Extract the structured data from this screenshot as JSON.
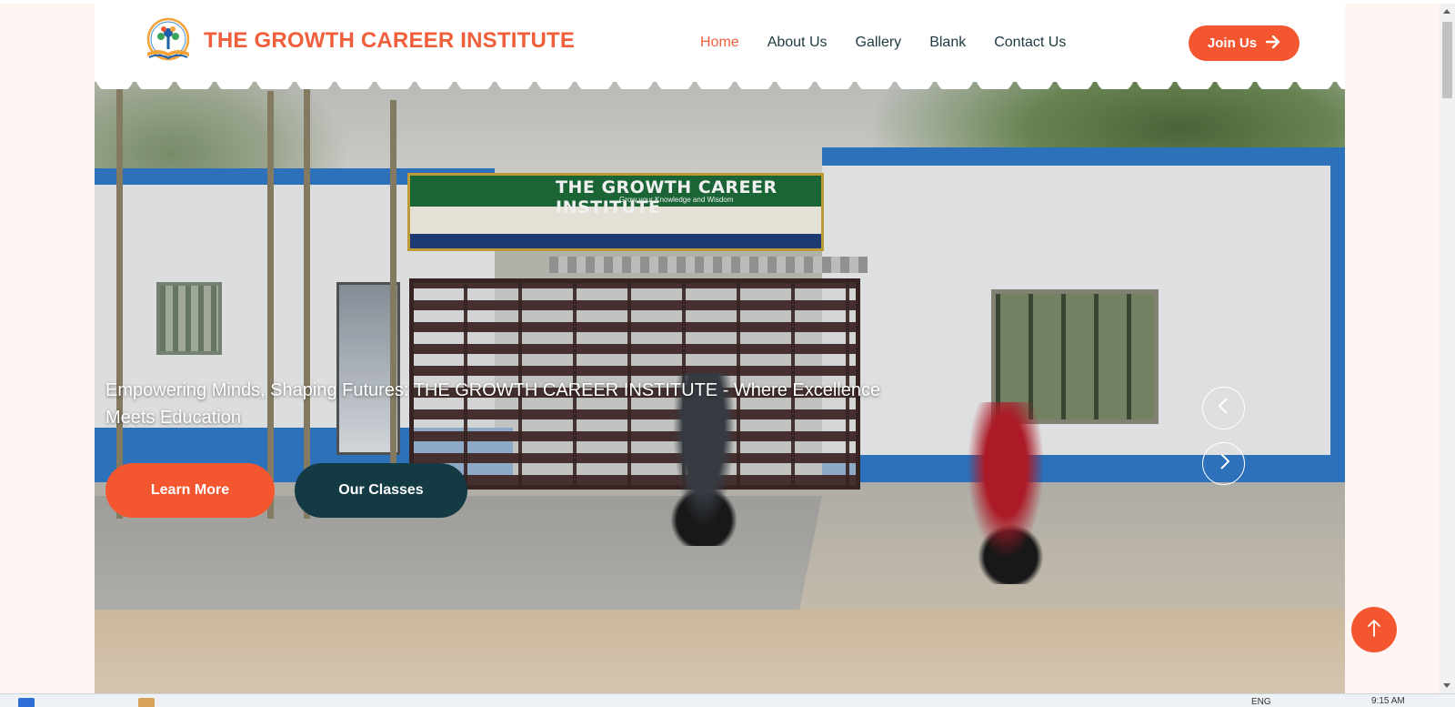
{
  "header": {
    "brand": "THE GROWTH CAREER INSTITUTE",
    "logo_icon": "open-book-tree-logo",
    "nav": [
      {
        "label": "Home",
        "active": true
      },
      {
        "label": "About Us",
        "active": false
      },
      {
        "label": "Gallery",
        "active": false
      },
      {
        "label": "Blank",
        "active": false
      },
      {
        "label": "Contact Us",
        "active": false
      }
    ],
    "join_label": "Join Us",
    "join_icon": "arrow-right-icon"
  },
  "hero": {
    "headline": "Empowering Minds, Shaping Futures: THE GROWTH CAREER INSTITUTE - Where Excellence Meets Education",
    "learn_more": "Learn More",
    "our_classes": "Our Classes",
    "sign_title": "THE GROWTH CAREER INSTITUTE",
    "sign_subtitle": "Grow your Knowledge and Wisdom",
    "carousel_prev_icon": "chevron-left-icon",
    "carousel_next_icon": "chevron-right-icon"
  },
  "back_to_top_icon": "arrow-up-icon",
  "taskbar": {
    "lang": "ENG",
    "time": "9:15 AM"
  },
  "colors": {
    "accent": "#f4572f",
    "brand_text": "#f05f3b",
    "dark_teal": "#143a44",
    "nav_text": "#1d3a40",
    "page_bg": "#fff5f3"
  }
}
